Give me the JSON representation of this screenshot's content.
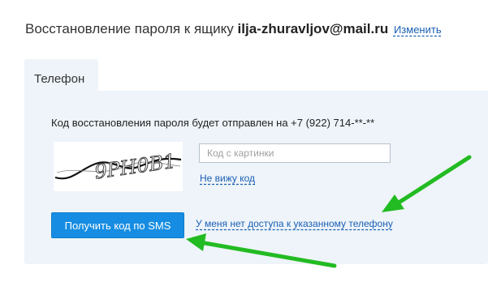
{
  "header": {
    "title_prefix": "Восстановление пароля к ящику",
    "email": "ilja-zhuravljov@mail.ru",
    "change_link": "Изменить"
  },
  "tabs": [
    {
      "label": "Телефон"
    }
  ],
  "panel": {
    "info_text": "Код восстановления пароля будет отправлен на +7 (922) 714-**-**",
    "captcha": {
      "image_text": "9PH0B1",
      "input_placeholder": "Код с картинки",
      "input_value": "",
      "refresh_link": "Не вижу код"
    },
    "sms_button_label": "Получить код по SMS",
    "no_access_link": "У меня нет доступа к указанному телефону"
  },
  "colors": {
    "accent_button": "#168de2",
    "link": "#1a5fb4",
    "panel_background": "#eef4f9",
    "annotation_arrow": "#22bb22"
  },
  "icons": {
    "annotation": "arrow-icon"
  }
}
